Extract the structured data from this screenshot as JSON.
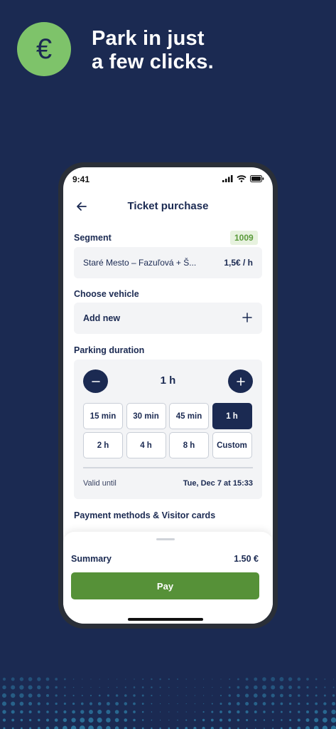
{
  "promo": {
    "badge_symbol": "€",
    "headline_line1": "Park in just",
    "headline_line2": "a few clicks."
  },
  "status_bar": {
    "time": "9:41"
  },
  "header": {
    "title": "Ticket purchase"
  },
  "segment": {
    "label": "Segment",
    "code": "1009",
    "name": "Staré Mesto – Fazuľová + Š...",
    "price": "1,5€ / h"
  },
  "vehicle": {
    "label": "Choose vehicle",
    "add_label": "Add new"
  },
  "duration": {
    "label": "Parking duration",
    "value": "1 h",
    "options": [
      "15 min",
      "30 min",
      "45 min",
      "1 h",
      "2 h",
      "4 h",
      "8 h",
      "Custom"
    ],
    "selected": "1 h",
    "valid_label": "Valid until",
    "valid_value": "Tue, Dec 7 at 15:33"
  },
  "payment": {
    "label": "Payment methods & Visitor cards"
  },
  "summary": {
    "label": "Summary",
    "value": "1.50 €",
    "pay_label": "Pay"
  },
  "colors": {
    "background": "#1b2a52",
    "accent_green": "#7ec36a",
    "pay_green": "#569138"
  }
}
